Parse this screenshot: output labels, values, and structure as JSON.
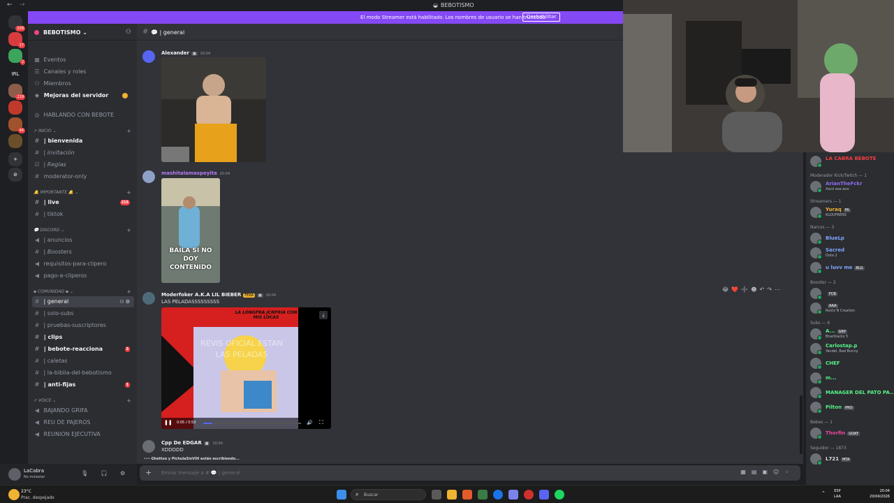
{
  "window": {
    "title": "BEBOTISMO"
  },
  "banner": {
    "message": "El modo Streamer está habilitado. Los nombres de usuario se han truncado.",
    "button": "Deshabilitar"
  },
  "servers": [
    {
      "label": "",
      "badge": "528",
      "color": "#313338"
    },
    {
      "label": "",
      "badge": "17",
      "color": "#d83c3e"
    },
    {
      "label": "",
      "badge": "2",
      "color": "#3ba55c"
    },
    {
      "label": "IRL",
      "badge": "",
      "color": "#1e1f22"
    },
    {
      "label": "",
      "badge": "219",
      "color": "#8e5c4b"
    },
    {
      "label": "",
      "badge": "",
      "color": "#c0392b"
    },
    {
      "label": "",
      "badge": "44",
      "color": "#a0522d"
    },
    {
      "label": "",
      "badge": "",
      "color": "#6b4f2a"
    },
    {
      "label": "+",
      "badge": "",
      "color": "#313338"
    },
    {
      "label": "⊘",
      "badge": "",
      "color": "#313338"
    }
  ],
  "server": {
    "name": "BEBOTISMO"
  },
  "sidebar": {
    "top_items": [
      "Eventos",
      "Canales y roles",
      "Miembros",
      "Mejoras del servidor"
    ],
    "hablando": "HABLANDO CON BEBOTE",
    "categories": {
      "inicio": "INICIO",
      "importante": "IMPORTANTE",
      "discord": "DISCORD",
      "comunidad": "COMUNIDAD",
      "voice": "VOICE"
    },
    "channels": {
      "bienvenida": "| bienvenida",
      "invitacion": "| invitación",
      "reglas": "| Reglas",
      "moderator": "moderator-only",
      "live": "| live",
      "live_badge": "215",
      "tiktok": "| tiktok",
      "anuncios": "| anuncios",
      "boosters": "| Boosters",
      "requisitos": "requisitos-para-clipero",
      "pago": "pago-a-cliperos",
      "general": "| general",
      "solo_subs": "| solo-subs",
      "pruebas": "| pruebas-suscriptores",
      "clips": "| clips",
      "reacciona": "| bebote-reacciona",
      "reacciona_badge": "3",
      "caletas": "| caletas",
      "biblia": "| la-biblia-del-bebotismo",
      "antifijas": "| anti-fijas",
      "antifijas_badge": "1",
      "bajando": "BAJANDO GRIFA",
      "reu": "REU DE PAJEROS",
      "reunion": "REUNION EJECUTIVA"
    }
  },
  "user": {
    "name": "LaCabra",
    "status": "No molestar"
  },
  "chat": {
    "channel": "| general",
    "messages": [
      {
        "author": "Alexander",
        "time": "20:04",
        "text": ""
      },
      {
        "author": "mashitalamaspeyita",
        "time": "20:04",
        "text": "",
        "caption": "BAILA SI NO DOY CONTENIDO"
      },
      {
        "author": "Moderfoker A.K.A LIL BIEBER",
        "tag": "FEKA",
        "time": "20:04",
        "text": "LAS PELADASSSSSSSSS",
        "video_time": "0:05 / 0:53",
        "video_overlay": "REVIS OFICIAL ESTAN LAS PELADAS",
        "video_heading": "LA LONGPRA JCNFRIA CON MIS LOCAS"
      },
      {
        "author": "Cpp De EDGAR",
        "time": "20:04",
        "text": "XDDDDD"
      }
    ],
    "typing": "Ghettoo y PichulaSinVIH están escribiendo...",
    "placeholder": "Enviar mensaje a # 💬 | general"
  },
  "members": {
    "top": {
      "name": "LA CABRA BEBOTE",
      "color": "#f23f43"
    },
    "groups": [
      {
        "title": "Moderador Kick/Twitch — 1",
        "items": [
          {
            "name": "ArianTheFckr",
            "sub": "Xocó ese ano",
            "color": "#8f6df0"
          }
        ]
      },
      {
        "title": "Streamers — 1",
        "items": [
          {
            "name": "Yuraq",
            "tag": "FA",
            "sub": "KLOUFRENS",
            "color": "#f0b232"
          }
        ]
      },
      {
        "title": "Narcos — 3",
        "items": [
          {
            "name": "BlueLp",
            "sub": "",
            "color": "#7ea6ff"
          },
          {
            "name": "Sacred",
            "sub": "Dota 2",
            "color": "#7ea6ff"
          },
          {
            "name": "u luvv me",
            "tag": "BLG",
            "sub": "",
            "color": "#7ea6ff"
          }
        ]
      },
      {
        "title": "Booster — 2",
        "items": [
          {
            "name": "",
            "tag": "FCB",
            "sub": "",
            "color": "#9b59b6"
          },
          {
            "name": "",
            "tag": "AAA",
            "sub": "Rootz N Creation",
            "color": "#9b59b6"
          }
        ]
      },
      {
        "title": "Subs — 6",
        "items": [
          {
            "name": "A...",
            "tag": "GRP",
            "sub": "BlueStacks 5",
            "color": "#57f287"
          },
          {
            "name": "Carlostap.p",
            "sub": "Yandel, Bad Bunny",
            "color": "#57f287"
          },
          {
            "name": "CHEF",
            "sub": "",
            "color": "#57f287"
          },
          {
            "name": "m...",
            "sub": "",
            "color": "#57f287"
          },
          {
            "name": "MANAGER DEL PATO PA...",
            "sub": "",
            "color": "#57f287"
          },
          {
            "name": "Pilton",
            "tag": "PRO",
            "sub": "",
            "color": "#57f287"
          }
        ]
      },
      {
        "title": "Bebes — 1",
        "items": [
          {
            "name": "Thorfin",
            "tag": "GOAT",
            "sub": "",
            "color": "#eb459e"
          }
        ]
      },
      {
        "title": "Seguidor — 1873",
        "items": [
          {
            "name": "L721",
            "tag": "MTA",
            "sub": "",
            "color": "#dbdee1"
          }
        ]
      }
    ]
  },
  "taskbar": {
    "temp": "23°C",
    "condition": "Prac. despejado",
    "search": "Buscar",
    "lang_top": "ESP",
    "lang_bottom": "LAA",
    "time": "20:04",
    "date": "20/04/2026"
  }
}
